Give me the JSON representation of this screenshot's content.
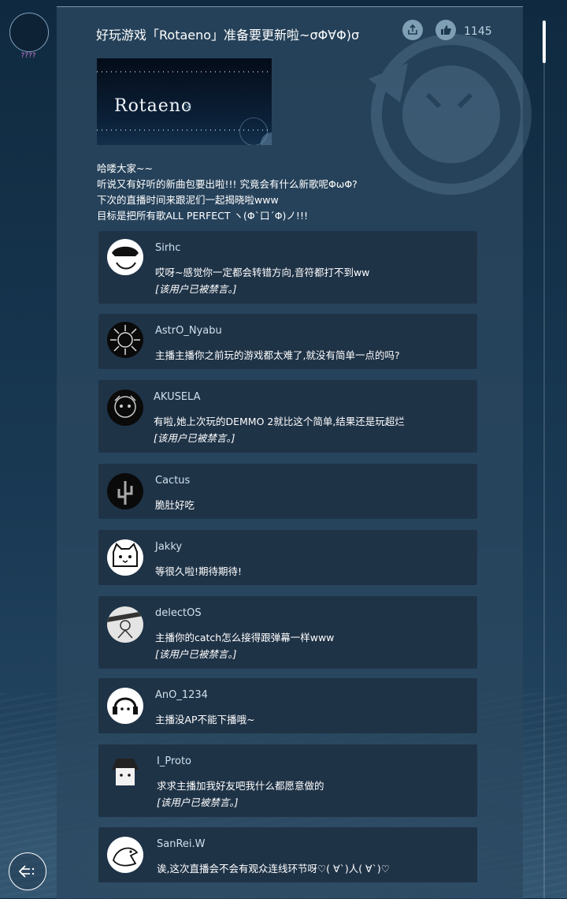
{
  "user": {
    "name": "????"
  },
  "post": {
    "title": "好玩游戏「Rotaeno」准备要更新啦~σΦ∀Φ)σ",
    "like_count": "1145",
    "banner_logo": "Rotaeno",
    "banner_x": "×",
    "body": [
      "哈喽大家~~",
      "听说又有好听的新曲包要出啦!!! 究竟会有什么新歌呢ΦωΦ?",
      "下次的直播时间来跟泥们一起揭晓啦www",
      "目标是把所有歌ALL PERFECT ヽ(Φ`口´Φ)ノ!!!"
    ]
  },
  "comments": [
    {
      "name": "Sirhc",
      "text": "哎呀~感觉你一定都会转错方向,音符都打不到ww",
      "banned": "[该用户已被禁言。]"
    },
    {
      "name": "AstrO_Nyabu",
      "text": "主播主播你之前玩的游戏都太难了,就没有简单一点的吗?"
    },
    {
      "name": "AKUSELA",
      "text": "有啦,她上次玩的DEMMO 2就比这个简单,结果还是玩超烂",
      "banned": "[该用户已被禁言。]"
    },
    {
      "name": "Cactus",
      "text": "脆肚好吃"
    },
    {
      "name": "Jakky",
      "text": "等很久啦!期待期待!"
    },
    {
      "name": "delectOS",
      "text": "主播你的catch怎么接得跟弹幕一样www",
      "banned": "[该用户已被禁言。]"
    },
    {
      "name": "AnO_1234",
      "text": "主播没AP不能下播哦~"
    },
    {
      "name": "I_Proto",
      "text": "求求主播加我好友吧我什么都愿意做的",
      "banned": "[该用户已被禁言。]"
    },
    {
      "name": "SanRei.W",
      "text": "诶,这次直播会不会有观众连线环节呀♡( ∀`)人( ∀`)♡"
    }
  ],
  "icons": {
    "share": "share-icon",
    "like": "thumbs-up-icon",
    "back": "back-icon"
  }
}
